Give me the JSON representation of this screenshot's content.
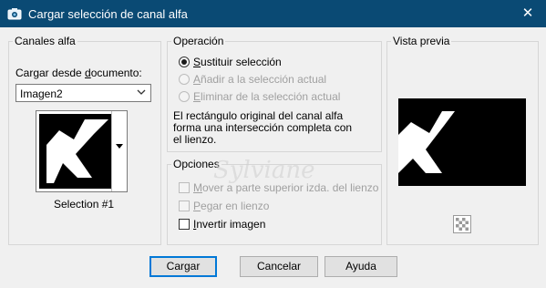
{
  "window": {
    "title": "Cargar selección de canal alfa",
    "close_glyph": "✕",
    "icon": "camera-icon"
  },
  "canales_alfa": {
    "group_label": "Canales alfa",
    "load_from_label_pre": "Cargar desde ",
    "load_from_label_u": "d",
    "load_from_label_post": "ocumento:",
    "document_value": "Imagen2",
    "selection_caption": "Selection #1"
  },
  "operacion": {
    "group_label": "Operación",
    "options": [
      {
        "u": "S",
        "rest": "ustituir selección",
        "checked": true,
        "enabled": true
      },
      {
        "u": "A",
        "rest": "ñadir a la selección actual",
        "checked": false,
        "enabled": false
      },
      {
        "u": "E",
        "rest": "liminar de la selección actual",
        "checked": false,
        "enabled": false
      }
    ],
    "info_lines": [
      "El rectángulo original del canal alfa",
      "forma una intersección completa con",
      "el lienzo."
    ]
  },
  "opciones": {
    "group_label": "Opciones",
    "items": [
      {
        "u": "M",
        "rest": "over a parte superior izda. del lienzo",
        "checked": false,
        "enabled": false
      },
      {
        "u": "P",
        "rest": "egar en lienzo",
        "checked": false,
        "enabled": false
      },
      {
        "u": "I",
        "rest": "nvertir imagen",
        "checked": false,
        "enabled": true
      }
    ]
  },
  "vista_previa": {
    "group_label": "Vista previa",
    "transparency_icon": "checkerboard-icon"
  },
  "buttons": {
    "ok": "Cargar",
    "cancel": "Cancelar",
    "help": "Ayuda"
  },
  "watermark": "Sylviane",
  "colors": {
    "titlebar": "#0a4a74",
    "dialog_bg": "#f0f0f0",
    "default_button_border": "#0078d7"
  }
}
